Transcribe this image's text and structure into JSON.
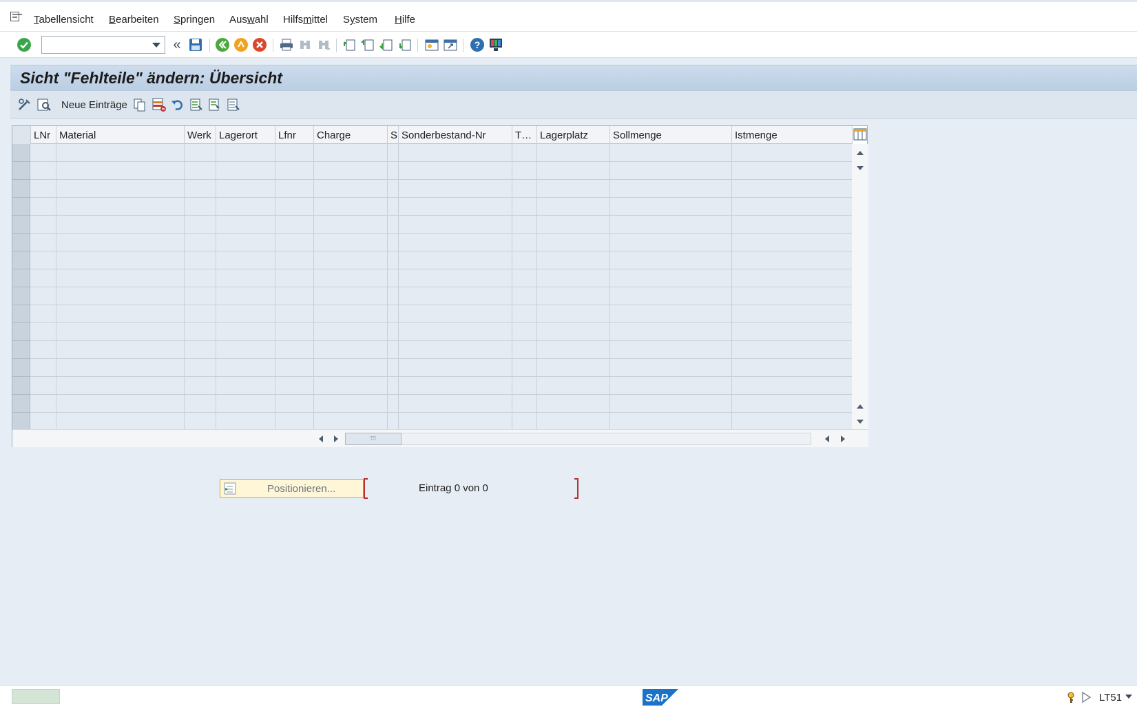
{
  "menubar": {
    "items": [
      {
        "pre": "",
        "u": "T",
        "post": "abellensicht"
      },
      {
        "pre": "",
        "u": "B",
        "post": "earbeiten"
      },
      {
        "pre": "",
        "u": "S",
        "post": "pringen"
      },
      {
        "pre": "Aus",
        "u": "w",
        "post": "ahl"
      },
      {
        "pre": "Hilfs",
        "u": "m",
        "post": "ittel"
      },
      {
        "pre": "S",
        "u": "y",
        "post": "stem"
      },
      {
        "pre": "",
        "u": "H",
        "post": "ilfe"
      }
    ]
  },
  "toolbar": {
    "command_value": "",
    "back_chevron": "«"
  },
  "screen": {
    "title": "Sicht \"Fehlteile\" ändern: Übersicht"
  },
  "apptoolbar": {
    "new_entries_label": "Neue Einträge"
  },
  "table": {
    "columns": [
      "LNr",
      "Material",
      "Werk",
      "Lagerort",
      "Lfnr",
      "Charge",
      "S",
      "Sonderbestand-Nr",
      "T…",
      "Lagerplatz",
      "Sollmenge",
      "Istmenge"
    ],
    "row_count": 16
  },
  "positioning": {
    "button_label": "Positionieren...",
    "entry_info": "Eintrag 0 von 0"
  },
  "statusbar": {
    "tcode": "LT51"
  },
  "colors": {
    "title_gradient_top": "#cedced",
    "grid_body": "#e5ebf2",
    "accept_green": "#3aa64a",
    "cancel_red": "#d9482b"
  }
}
